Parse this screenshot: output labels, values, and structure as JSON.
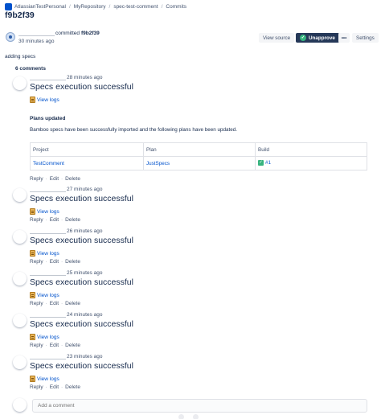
{
  "breadcrumb": [
    "AtlassianTestPersonal",
    "MyRepository",
    "spec-test-comment",
    "Commits"
  ],
  "commit": {
    "title": "f9b2f39",
    "committed_text": "committed",
    "hash": "f9b2f39",
    "time": "30 minutes ago",
    "message": "adding specs"
  },
  "toolbar": {
    "view_source": "View source",
    "unapprove": "Unapprove",
    "more": "•••",
    "settings": "Settings"
  },
  "comments_count": "6 comments",
  "comment_title": "Specs execution successful",
  "view_logs": "View logs",
  "actions": {
    "reply": "Reply",
    "edit": "Edit",
    "delete": "Delete"
  },
  "comments": [
    {
      "time": "28 minutes ago"
    },
    {
      "time": "27 minutes ago"
    },
    {
      "time": "26 minutes ago"
    },
    {
      "time": "25 minutes ago"
    },
    {
      "time": "24 minutes ago"
    },
    {
      "time": "23 minutes ago"
    }
  ],
  "plans": {
    "title": "Plans updated",
    "description": "Bamboo specs have been successfully imported and the following plans have been updated.",
    "headers": [
      "Project",
      "Plan",
      "Build"
    ],
    "rows": [
      {
        "project": "TestComment",
        "plan": "JustSpecs",
        "build": "#1"
      }
    ]
  },
  "add_comment_placeholder": "Add a comment",
  "icons": {
    "unapprove": "check-circle-icon",
    "logs": "scroll-icon",
    "build_status": "check-box-icon"
  },
  "colors": {
    "link": "#0052cc",
    "unapprove_bg": "#253858",
    "success": "#36b37e"
  }
}
